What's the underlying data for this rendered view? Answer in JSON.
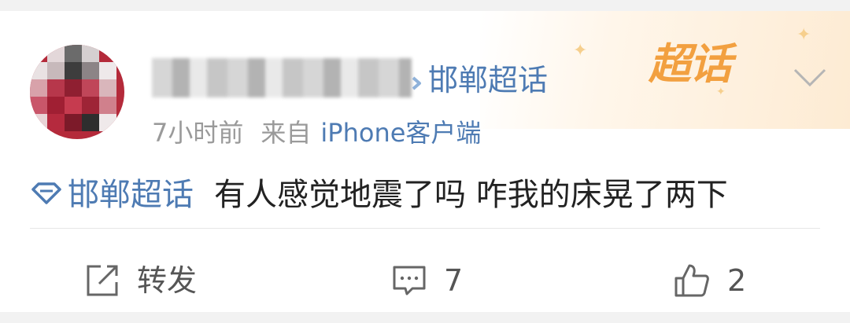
{
  "post": {
    "topic_name": "邯郸超话",
    "time": "7小时前",
    "source_prefix": "来自",
    "client": "iPhone客户端",
    "topic_tag": "邯郸超话",
    "content": "有人感觉地震了吗 咋我的床晃了两下"
  },
  "banner": {
    "logo_text": "超话"
  },
  "actions": {
    "repost_label": "转发",
    "comment_count": "7",
    "like_count": "2"
  },
  "colors": {
    "link": "#4e7bb3",
    "logo": "#f2a040",
    "text": "#222222",
    "meta": "#9a9a9a"
  }
}
